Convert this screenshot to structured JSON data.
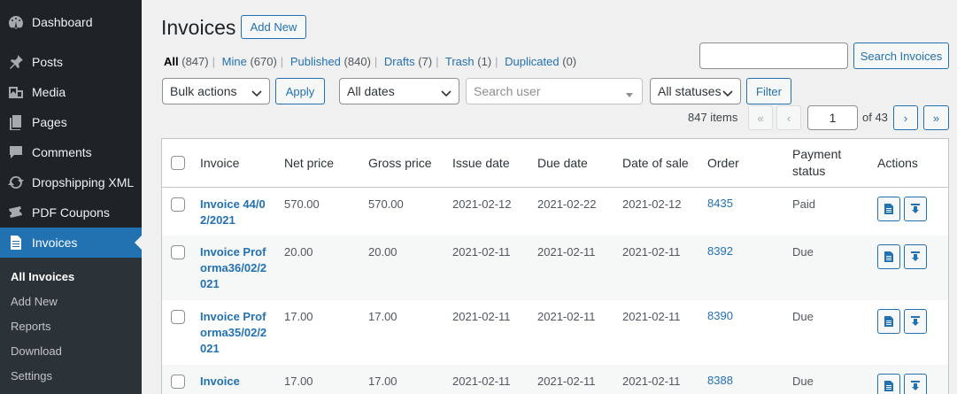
{
  "sidebar": {
    "menu": [
      {
        "label": "Dashboard",
        "icon": "dashboard-icon"
      },
      {
        "label": "Posts",
        "icon": "pin-icon"
      },
      {
        "label": "Media",
        "icon": "media-icon"
      },
      {
        "label": "Pages",
        "icon": "page-icon"
      },
      {
        "label": "Comments",
        "icon": "comment-icon"
      },
      {
        "label": "Dropshipping XML",
        "icon": "refresh-icon"
      },
      {
        "label": "PDF Coupons",
        "icon": "ticket-icon"
      },
      {
        "label": "Invoices",
        "icon": "document-icon",
        "active": true
      }
    ],
    "submenu": [
      "All Invoices",
      "Add New",
      "Reports",
      "Download",
      "Settings"
    ]
  },
  "header": {
    "title": "Invoices",
    "add_new": "Add New"
  },
  "views": [
    {
      "label": "All",
      "count": "(847)"
    },
    {
      "label": "Mine",
      "count": "(670)"
    },
    {
      "label": "Published",
      "count": "(840)"
    },
    {
      "label": "Drafts",
      "count": "(7)"
    },
    {
      "label": "Trash",
      "count": "(1)"
    },
    {
      "label": "Duplicated",
      "count": "(0)"
    }
  ],
  "search": {
    "value": "",
    "button": "Search Invoices"
  },
  "filters": {
    "bulk_actions": "Bulk actions",
    "apply": "Apply",
    "dates": "All dates",
    "user_placeholder": "Search user",
    "statuses": "All statuses",
    "filter": "Filter"
  },
  "pagination": {
    "items": "847 items",
    "first": "«",
    "prev": "‹",
    "current": "1",
    "of": "of 43",
    "next": "›",
    "last": "»"
  },
  "table": {
    "columns": [
      "Invoice",
      "Net price",
      "Gross price",
      "Issue date",
      "Due date",
      "Date of sale",
      "Order",
      "Payment status",
      "Actions"
    ],
    "rows": [
      {
        "invoice": "Invoice 44/02/2021",
        "net": "570.00",
        "gross": "570.00",
        "issue": "2021-02-12",
        "due": "2021-02-22",
        "sale": "2021-02-12",
        "order": "8435",
        "status": "Paid"
      },
      {
        "invoice": "Invoice Proforma36/02/2021",
        "net": "20.00",
        "gross": "20.00",
        "issue": "2021-02-11",
        "due": "2021-02-11",
        "sale": "2021-02-11",
        "order": "8392",
        "status": "Due"
      },
      {
        "invoice": "Invoice Proforma35/02/2021",
        "net": "17.00",
        "gross": "17.00",
        "issue": "2021-02-11",
        "due": "2021-02-11",
        "sale": "2021-02-11",
        "order": "8390",
        "status": "Due"
      },
      {
        "invoice": "Invoice",
        "net": "17.00",
        "gross": "17.00",
        "issue": "2021-02-11",
        "due": "2021-02-11",
        "sale": "2021-02-11",
        "order": "8388",
        "status": "Due"
      }
    ]
  },
  "colors": {
    "sidebar_bg": "#1d2327",
    "active_menu": "#2271b1",
    "link": "#2271b1",
    "page_bg": "#f0f0f1"
  }
}
